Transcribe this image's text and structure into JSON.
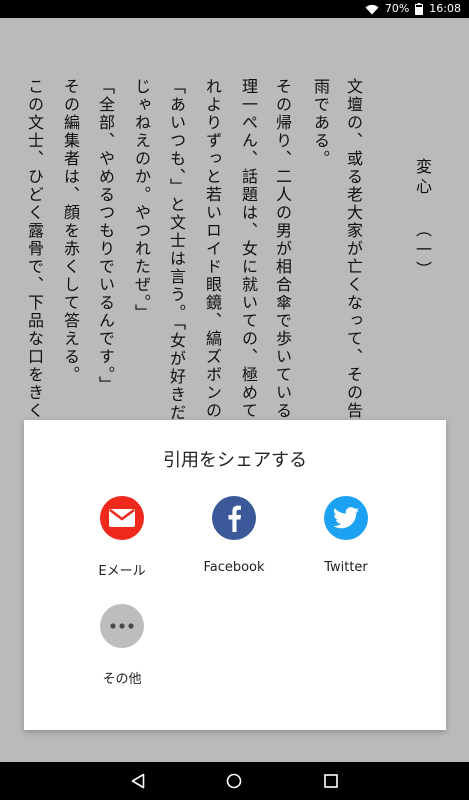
{
  "status_bar": {
    "battery": "70%",
    "time": "16:08"
  },
  "book": {
    "chapter_title": "変心 （一）",
    "columns": [
      "文壇の、或る老大家が亡くなって、その告別式",
      "雨である。",
      "その帰り、二人の男が相合傘で歩いている。",
      "理一ぺん、話題は、女に就いての、極めて不きん",
      "れよりずっと若いロイド眼鏡、縞ズボンの好男子",
      "「あいつも、」と文士は言う。「女が好きだったら",
      "じゃねえのか。やつれたぜ。」",
      "「全部、やめるつもりでいるんです。」",
      "その編集者は、顔を赤くして答える。",
      "この文士、ひどく露骨で、下品な口をきくので"
    ]
  },
  "share_sheet": {
    "title": "引用をシェアする",
    "items": [
      {
        "label": "Eメール",
        "icon": "email-icon",
        "color": "#f0291d"
      },
      {
        "label": "Facebook",
        "icon": "facebook-icon",
        "color": "#3b5998"
      },
      {
        "label": "Twitter",
        "icon": "twitter-icon",
        "color": "#1da1f2"
      },
      {
        "label": "その他",
        "icon": "more-icon",
        "color": "#bdbdbd"
      }
    ]
  }
}
